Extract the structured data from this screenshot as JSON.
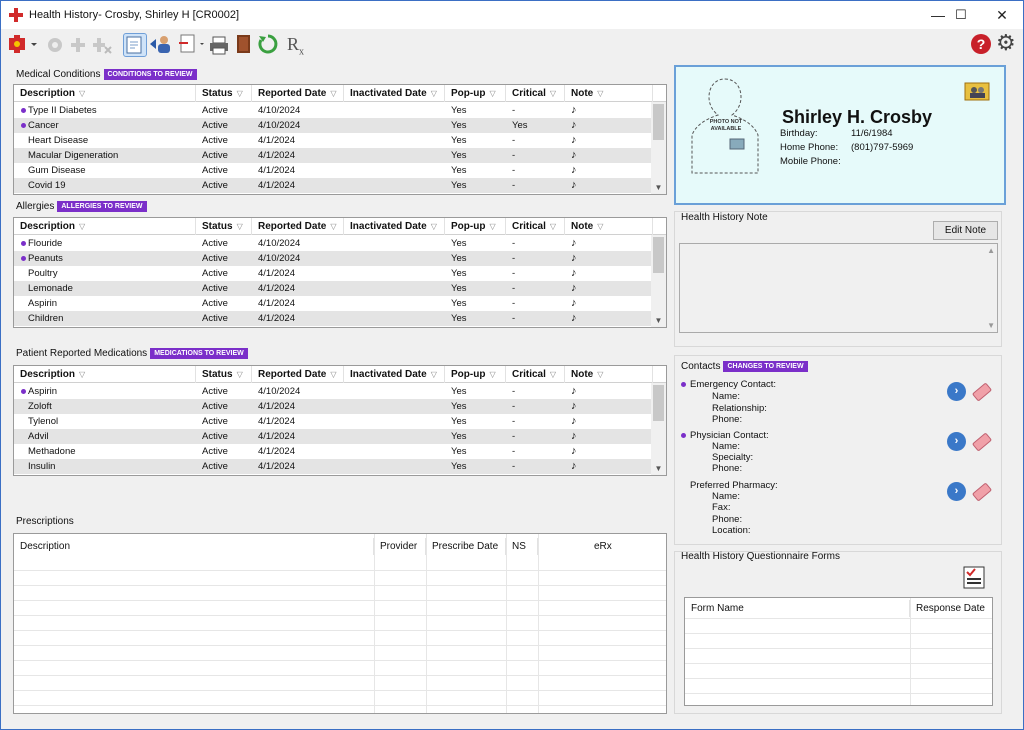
{
  "window": {
    "title": "Health History- Crosby, Shirley H [CR0002]",
    "minimize": "—",
    "maximize": "☐",
    "close": "✕"
  },
  "toolbar": {
    "rx_label": "R",
    "help_label": "?",
    "gear_glyph": "⚙"
  },
  "columns": {
    "description": "Description",
    "status": "Status",
    "reported": "Reported Date",
    "inactivated": "Inactivated Date",
    "popup": "Pop-up",
    "critical": "Critical",
    "note": "Note",
    "dd": "▽"
  },
  "conditions": {
    "label": "Medical Conditions",
    "badge": "CONDITIONS TO REVIEW",
    "rows": [
      {
        "d": "Type II Diabetes",
        "s": "Active",
        "r": "4/10/2024",
        "i": "",
        "p": "Yes",
        "c": "-",
        "n": "♪",
        "flag": true
      },
      {
        "d": "Cancer",
        "s": "Active",
        "r": "4/10/2024",
        "i": "",
        "p": "Yes",
        "c": "Yes",
        "n": "♪",
        "flag": true
      },
      {
        "d": "Heart Disease",
        "s": "Active",
        "r": "4/1/2024",
        "i": "",
        "p": "Yes",
        "c": "-",
        "n": "♪",
        "flag": false
      },
      {
        "d": "Macular Digeneration",
        "s": "Active",
        "r": "4/1/2024",
        "i": "",
        "p": "Yes",
        "c": "-",
        "n": "♪",
        "flag": false
      },
      {
        "d": "Gum Disease",
        "s": "Active",
        "r": "4/1/2024",
        "i": "",
        "p": "Yes",
        "c": "-",
        "n": "♪",
        "flag": false
      },
      {
        "d": "Covid 19",
        "s": "Active",
        "r": "4/1/2024",
        "i": "",
        "p": "Yes",
        "c": "-",
        "n": "♪",
        "flag": false
      }
    ]
  },
  "allergies": {
    "label": "Allergies",
    "badge": "ALLERGIES TO REVIEW",
    "rows": [
      {
        "d": "Flouride",
        "s": "Active",
        "r": "4/10/2024",
        "i": "",
        "p": "Yes",
        "c": "-",
        "n": "♪",
        "flag": true
      },
      {
        "d": "Peanuts",
        "s": "Active",
        "r": "4/10/2024",
        "i": "",
        "p": "Yes",
        "c": "-",
        "n": "♪",
        "flag": true
      },
      {
        "d": "Poultry",
        "s": "Active",
        "r": "4/1/2024",
        "i": "",
        "p": "Yes",
        "c": "-",
        "n": "♪",
        "flag": false
      },
      {
        "d": "Lemonade",
        "s": "Active",
        "r": "4/1/2024",
        "i": "",
        "p": "Yes",
        "c": "-",
        "n": "♪",
        "flag": false
      },
      {
        "d": "Aspirin",
        "s": "Active",
        "r": "4/1/2024",
        "i": "",
        "p": "Yes",
        "c": "-",
        "n": "♪",
        "flag": false
      },
      {
        "d": "Children",
        "s": "Active",
        "r": "4/1/2024",
        "i": "",
        "p": "Yes",
        "c": "-",
        "n": "♪",
        "flag": false
      }
    ]
  },
  "medications": {
    "label": "Patient Reported Medications",
    "badge": "MEDICATIONS TO REVIEW",
    "rows": [
      {
        "d": "Aspirin",
        "s": "Active",
        "r": "4/10/2024",
        "i": "",
        "p": "Yes",
        "c": "-",
        "n": "♪",
        "flag": true
      },
      {
        "d": "Zoloft",
        "s": "Active",
        "r": "4/1/2024",
        "i": "",
        "p": "Yes",
        "c": "-",
        "n": "♪",
        "flag": false
      },
      {
        "d": "Tylenol",
        "s": "Active",
        "r": "4/1/2024",
        "i": "",
        "p": "Yes",
        "c": "-",
        "n": "♪",
        "flag": false
      },
      {
        "d": "Advil",
        "s": "Active",
        "r": "4/1/2024",
        "i": "",
        "p": "Yes",
        "c": "-",
        "n": "♪",
        "flag": false
      },
      {
        "d": "Methadone",
        "s": "Active",
        "r": "4/1/2024",
        "i": "",
        "p": "Yes",
        "c": "-",
        "n": "♪",
        "flag": false
      },
      {
        "d": "Insulin",
        "s": "Active",
        "r": "4/1/2024",
        "i": "",
        "p": "Yes",
        "c": "-",
        "n": "♪",
        "flag": false
      }
    ]
  },
  "prescriptions": {
    "label": "Prescriptions",
    "cols": {
      "description": "Description",
      "provider": "Provider",
      "date": "Prescribe Date",
      "ns": "NS",
      "erx": "eRx"
    }
  },
  "patient": {
    "name": "Shirley H. Crosby",
    "birthday_label": "Birthday:",
    "birthday": "11/6/1984",
    "home_label": "Home Phone:",
    "home": "(801)797-5969",
    "mobile_label": "Mobile Phone:",
    "mobile": "",
    "photo_text": "PHOTO NOT AVAILABLE"
  },
  "hh_note": {
    "label": "Health History Note",
    "edit_button": "Edit Note"
  },
  "contacts": {
    "label": "Contacts",
    "badge": "CHANGES TO REVIEW",
    "emergency": {
      "title": "Emergency Contact:",
      "f1": "Name:",
      "f2": "Relationship:",
      "f3": "Phone:"
    },
    "physician": {
      "title": "Physician Contact:",
      "f1": "Name:",
      "f2": "Specialty:",
      "f3": "Phone:"
    },
    "pharmacy": {
      "title": "Preferred Pharmacy:",
      "f1": "Name:",
      "f2": "Fax:",
      "f3": "Phone:",
      "f4": "Location:"
    }
  },
  "questionnaire": {
    "label": "Health History Questionnaire Forms",
    "col_form": "Form Name",
    "col_resp": "Response Date"
  }
}
